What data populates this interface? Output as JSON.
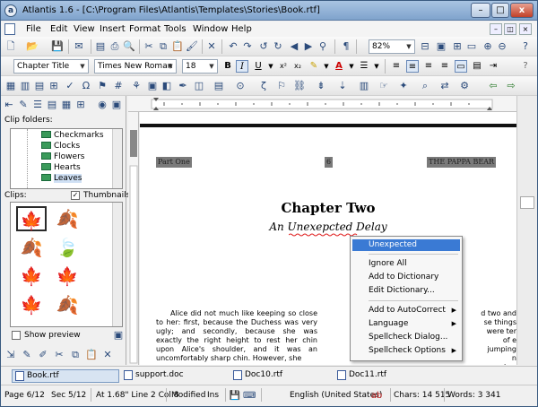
{
  "window": {
    "title": "Atlantis 1.6 - [C:\\Program Files\\Atlantis\\Templates\\Stories\\Book.rtf]",
    "app_icon_glyph": "a"
  },
  "title_buttons": {
    "minimize": "–",
    "maximize": "□",
    "close": "x"
  },
  "menu": [
    "File",
    "Edit",
    "View",
    "Insert",
    "Format",
    "Tools",
    "Window",
    "Help"
  ],
  "standard_toolbar": {
    "zoom": "82%",
    "paragraph_mark": "¶"
  },
  "format_toolbar": {
    "style": "Chapter Title",
    "font": "Times New Roman",
    "size": "18",
    "bold": "B",
    "italic": "I",
    "underline": "U",
    "superscript": "x²",
    "subscript": "x₂",
    "font_color": "A"
  },
  "left_panel": {
    "clip_folders_label": "Clip folders:",
    "folders": [
      "Checkmarks",
      "Clocks",
      "Flowers",
      "Hearts",
      "Leaves"
    ],
    "selected_folder": "Leaves",
    "clips_label": "Clips:",
    "thumbnails_label": "Thumbnails",
    "thumbnails_checked": true,
    "show_preview_label": "Show preview",
    "show_preview_checked": false
  },
  "document": {
    "header_left": "Part One",
    "header_center": "6",
    "header_right": "THE PAPPA BEAR",
    "chapter_title": "Chapter Two",
    "chapter_subtitle": "An Unexepcted Delay",
    "paragraph_left": "Alice did not much like keeping so close to her: first, because the Duchess was very ugly; and secondly, because she was exactly the right height to rest her chin upon Alice's shoulder, and it was an uncomfortably sharp chin. However, she",
    "paragraph_right": "d two and se things were ter of e jumping n couples: th hearts."
  },
  "context_menu": {
    "items": [
      {
        "label": "Unexpected",
        "highlighted": true
      },
      {
        "label": "Ignore All"
      },
      {
        "label": "Add to Dictionary"
      },
      {
        "label": "Edit Dictionary..."
      },
      {
        "label": "Add to AutoCorrect",
        "submenu": true
      },
      {
        "label": "Language",
        "submenu": true
      },
      {
        "label": "Spellcheck Dialog..."
      },
      {
        "label": "Spellcheck Options",
        "submenu": true
      }
    ]
  },
  "doc_tabs": [
    {
      "label": "Book.rtf",
      "active": true
    },
    {
      "label": "support.doc"
    },
    {
      "label": "Doc10.rtf"
    },
    {
      "label": "Doc11.rtf"
    }
  ],
  "status": {
    "page": "Page 6/12",
    "sec": "Sec 5/12",
    "position": "At 1.68\"  Line 2  Col 8",
    "modified": "Modified",
    "ins": "Ins",
    "language": "English (United States)",
    "chars": "Chars: 14 515",
    "words": "Words: 3 341"
  }
}
